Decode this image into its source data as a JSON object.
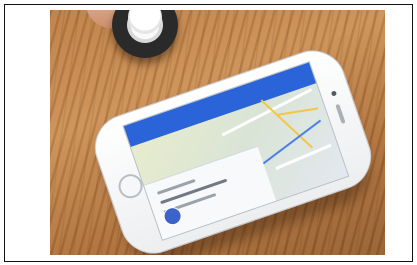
{
  "image": {
    "description_visible": false
  },
  "colors": {
    "frame_border": "#111111",
    "table_wood": "#b97a43",
    "phone_body": "#ffffff",
    "app_header": "#2b63d8",
    "map_road_yellow": "#f1c744",
    "map_road_blue": "#4c7fe6",
    "beacon_ring": "#2a2a2a",
    "fab": "#3b63c9"
  },
  "icons": {
    "home_button": "home-button-icon",
    "fab": "action-button-icon",
    "beacon": "beacon-icon"
  }
}
